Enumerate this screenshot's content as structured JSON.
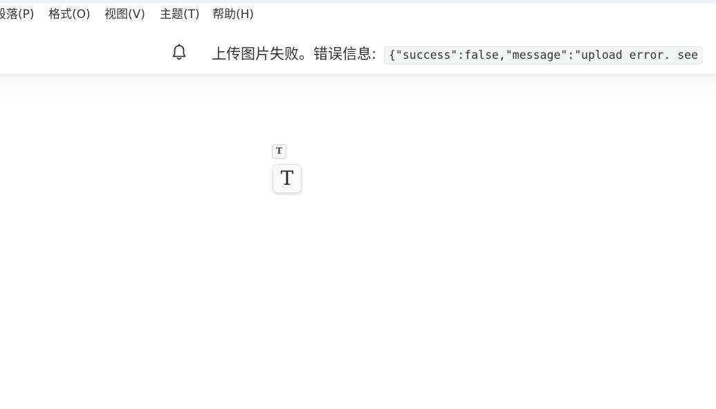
{
  "menubar": {
    "items": [
      {
        "label": "段落(P)"
      },
      {
        "label": "格式(O)"
      },
      {
        "label": "视图(V)"
      },
      {
        "label": "主题(T)"
      },
      {
        "label": "帮助(H)"
      }
    ]
  },
  "notification": {
    "icon": "bell-icon",
    "message": "上传图片失败。错误信息:",
    "code": "{\"success\":false,\"message\":\"upload error. see"
  },
  "editor": {
    "small_block_glyph": "T",
    "large_block_glyph": "T"
  },
  "colors": {
    "text": "#333333",
    "code_background": "#f3f4f4",
    "window_top": "#eef1f6"
  }
}
